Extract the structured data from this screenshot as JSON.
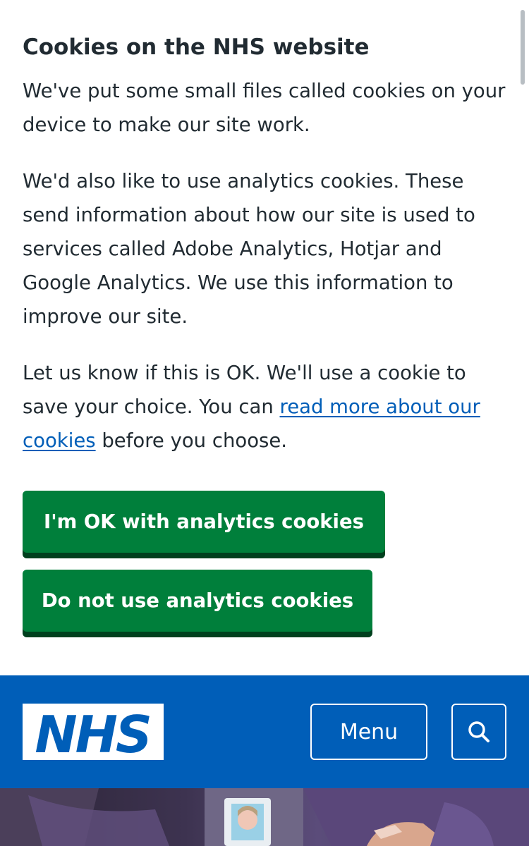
{
  "cookie_banner": {
    "title": "Cookies on the NHS website",
    "paragraph_1": "We've put some small files called cookies on your device to make our site work.",
    "paragraph_2": "We'd also like to use analytics cookies. These send information about how our site is used to services called Adobe Analytics, Hotjar and Google Analytics. We use this information to improve our site.",
    "paragraph_3_before": "Let us know if this is OK. We'll use a cookie to save your choice. You can ",
    "paragraph_3_link": "read more about our cookies",
    "paragraph_3_after": " before you choose.",
    "accept_button": "I'm OK with analytics cookies",
    "reject_button": "Do not use analytics cookies"
  },
  "header": {
    "logo_text": "NHS",
    "menu_button": "Menu",
    "search_icon": "search-icon"
  },
  "colors": {
    "nhs_blue": "#005eb8",
    "button_green": "#007f3b",
    "button_shadow": "#00401e",
    "text": "#212b32",
    "link": "#005eb8"
  }
}
